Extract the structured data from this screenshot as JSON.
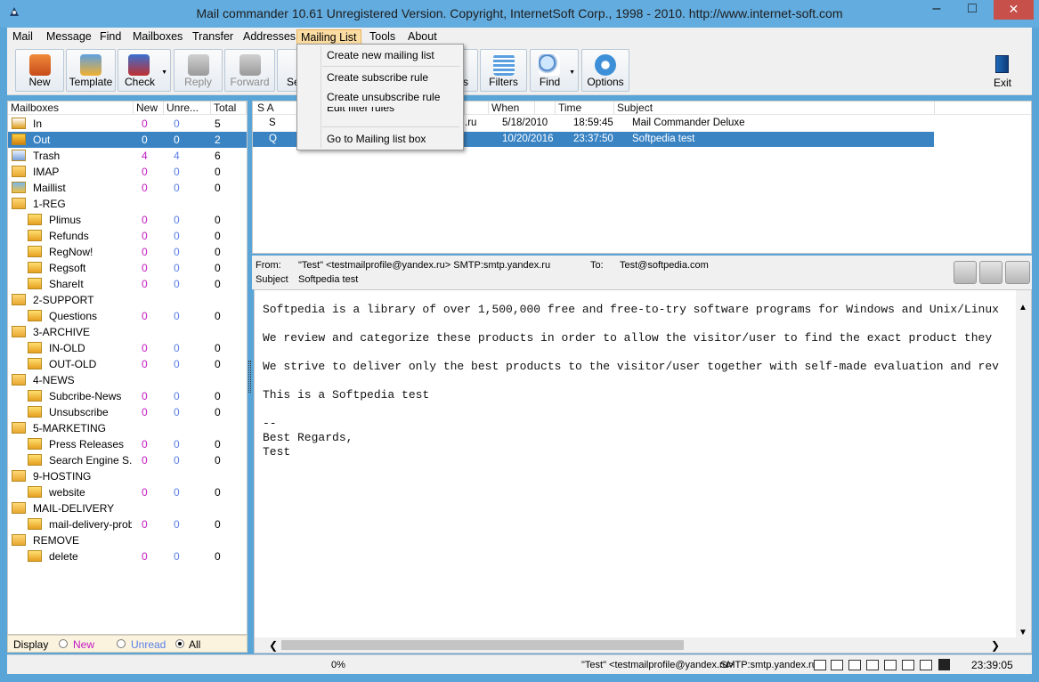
{
  "window": {
    "title": "Mail commander 10.61 Unregistered Version. Copyright, InternetSoft Corp., 1998 - 2010. http://www.internet-soft.com",
    "minimize": "–",
    "maximize": "□",
    "close": "✕"
  },
  "menu": [
    "Mail",
    "Message",
    "Find",
    "Mailboxes",
    "Transfer",
    "Addresses",
    "Mailing List",
    "Tools",
    "About"
  ],
  "toolbar": {
    "new": "New",
    "template": "Template",
    "check": "Check",
    "reply": "Reply",
    "forward": "Forward",
    "send": "Se",
    "rules": "s",
    "filters": "Filters",
    "find": "Find",
    "options": "Options",
    "exit": "Exit"
  },
  "dropdown": {
    "create_mailing_list": "Create new mailing list",
    "create_subscribe": "Create subscribe rule",
    "create_unsubscribe": "Create unsubscribe rule",
    "edit_filter": "Edit filter rules",
    "goto_box": "Go to Mailing list box"
  },
  "mailboxes": {
    "columns": [
      "Mailboxes",
      "New",
      "Unre...",
      "Total"
    ],
    "rows": [
      {
        "name": "In",
        "new": "0",
        "unread": "0",
        "total": "5",
        "indent": 0,
        "icon": "inbox-icon"
      },
      {
        "name": "Out",
        "new": "0",
        "unread": "0",
        "total": "2",
        "indent": 0,
        "icon": "outbox-icon",
        "selected": true
      },
      {
        "name": "Trash",
        "new": "4",
        "unread": "4",
        "total": "6",
        "indent": 0,
        "icon": "trash-icon"
      },
      {
        "name": "IMAP",
        "new": "0",
        "unread": "0",
        "total": "0",
        "indent": 0,
        "icon": "folder-icon"
      },
      {
        "name": "Maillist",
        "new": "0",
        "unread": "0",
        "total": "0",
        "indent": 0,
        "icon": "maillist-icon"
      },
      {
        "name": "1-REG",
        "indent": 0,
        "icon": "folder-icon",
        "group": true
      },
      {
        "name": "Plimus",
        "new": "0",
        "unread": "0",
        "total": "0",
        "indent": 1,
        "icon": "mail-folder-icon"
      },
      {
        "name": "Refunds",
        "new": "0",
        "unread": "0",
        "total": "0",
        "indent": 1,
        "icon": "mail-folder-icon"
      },
      {
        "name": "RegNow!",
        "new": "0",
        "unread": "0",
        "total": "0",
        "indent": 1,
        "icon": "mail-folder-icon"
      },
      {
        "name": "Regsoft",
        "new": "0",
        "unread": "0",
        "total": "0",
        "indent": 1,
        "icon": "mail-folder-icon"
      },
      {
        "name": "ShareIt",
        "new": "0",
        "unread": "0",
        "total": "0",
        "indent": 1,
        "icon": "mail-folder-icon"
      },
      {
        "name": "2-SUPPORT",
        "indent": 0,
        "icon": "folder-icon",
        "group": true
      },
      {
        "name": "Questions",
        "new": "0",
        "unread": "0",
        "total": "0",
        "indent": 1,
        "icon": "mail-folder-icon"
      },
      {
        "name": "3-ARCHIVE",
        "indent": 0,
        "icon": "folder-icon",
        "group": true
      },
      {
        "name": "IN-OLD",
        "new": "0",
        "unread": "0",
        "total": "0",
        "indent": 1,
        "icon": "mail-folder-icon"
      },
      {
        "name": "OUT-OLD",
        "new": "0",
        "unread": "0",
        "total": "0",
        "indent": 1,
        "icon": "mail-folder-icon"
      },
      {
        "name": "4-NEWS",
        "indent": 0,
        "icon": "folder-icon",
        "group": true
      },
      {
        "name": "Subcribe-News",
        "new": "0",
        "unread": "0",
        "total": "0",
        "indent": 1,
        "icon": "mail-folder-icon"
      },
      {
        "name": "Unsubscribe",
        "new": "0",
        "unread": "0",
        "total": "0",
        "indent": 1,
        "icon": "mail-folder-icon"
      },
      {
        "name": "5-MARKETING",
        "indent": 0,
        "icon": "folder-icon",
        "group": true
      },
      {
        "name": "Press Releases",
        "new": "0",
        "unread": "0",
        "total": "0",
        "indent": 1,
        "icon": "mail-folder-icon"
      },
      {
        "name": "Search Engine S...",
        "new": "0",
        "unread": "0",
        "total": "0",
        "indent": 1,
        "icon": "mail-folder-icon"
      },
      {
        "name": "9-HOSTING",
        "indent": 0,
        "icon": "folder-icon",
        "group": true
      },
      {
        "name": "website",
        "new": "0",
        "unread": "0",
        "total": "0",
        "indent": 1,
        "icon": "mail-folder-icon"
      },
      {
        "name": "MAIL-DELIVERY",
        "indent": 0,
        "icon": "folder-icon",
        "group": true
      },
      {
        "name": "mail-delivery-prob...",
        "new": "0",
        "unread": "0",
        "total": "0",
        "indent": 1,
        "icon": "mail-folder-icon"
      },
      {
        "name": "REMOVE",
        "indent": 0,
        "icon": "folder-icon",
        "group": true
      },
      {
        "name": "delete",
        "new": "0",
        "unread": "0",
        "total": "0",
        "indent": 1,
        "icon": "mail-folder-icon"
      }
    ]
  },
  "display": {
    "label": "Display",
    "new": "New",
    "unread": "Unread",
    "all": "All"
  },
  "messages": {
    "columns": [
      "S A",
      "When",
      "Time",
      "Subject"
    ],
    "rows": [
      {
        "s": "S",
        "from": ".ru",
        "when": "5/18/2010",
        "time": "18:59:45",
        "subject": "Mail Commander Deluxe"
      },
      {
        "s": "Q",
        "from": "",
        "when": "10/20/2016",
        "time": "23:37:50",
        "subject": "Softpedia test",
        "selected": true
      }
    ]
  },
  "header": {
    "from_label": "From:",
    "from": "\"Test\" <testmailprofile@yandex.ru>  SMTP:smtp.yandex.ru",
    "to_label": "To:",
    "to": "Test@softpedia.com",
    "subject_label": "Subject",
    "subject": "Softpedia test"
  },
  "body": "Softpedia is a library of over 1,500,000 free and free-to-try software programs for Windows and Unix/Linux\n\nWe review and categorize these products in order to allow the visitor/user to find the exact product they\n\nWe strive to deliver only the best products to the visitor/user together with self-made evaluation and rev\n\nThis is a Softpedia test\n\n--\nBest Regards,\nTest",
  "status": {
    "progress": "0%",
    "sender": "\"Test\" <testmailprofile@yandex.ru>",
    "smtp": "SMTP:smtp.yandex.ru",
    "time": "23:39:05"
  }
}
